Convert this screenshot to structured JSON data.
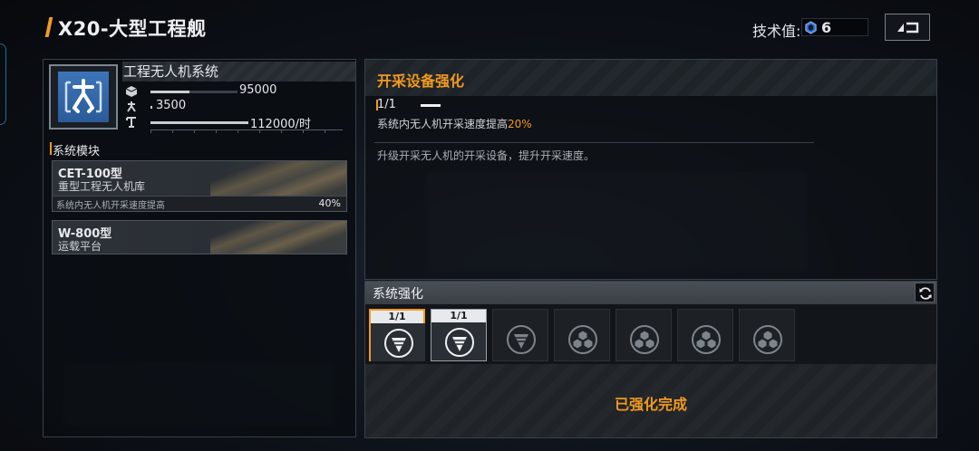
{
  "header": {
    "title": "X20-大型工程舰",
    "tech_label": "技术值:",
    "tech_value": "6",
    "tech_icon": "tech-gem-icon",
    "back_icon": "back-arrow-icon"
  },
  "system": {
    "name": "工程无人机系统",
    "icon": "drone-arm-icon",
    "stats": [
      {
        "icon": "cube-icon",
        "value": "95000",
        "fill": 0.45
      },
      {
        "icon": "drone-icon",
        "value": "3500",
        "fill": 0.02
      },
      {
        "icon": "crane-icon",
        "value": "112000/时",
        "fill": 0.5
      }
    ]
  },
  "modules": {
    "label": "系统模块",
    "items": [
      {
        "code": "CET-100型",
        "type": "重型工程无人机库",
        "desc": "系统内无人机开采速度提高",
        "pct": "40%"
      },
      {
        "code": "W-800型",
        "type": "运载平台"
      }
    ]
  },
  "upgrade": {
    "title": "开采设备强化",
    "level": "1/1",
    "effect_prefix": "系统内无人机开采速度提高",
    "effect_value": "20%",
    "description": "升级开采无人机的开采设备，提升开采速度。"
  },
  "enhance": {
    "title": "系统强化",
    "refresh_icon": "refresh-icon",
    "slots": [
      {
        "level": "1/1",
        "icon": "drill-icon",
        "state": "selected"
      },
      {
        "level": "1/1",
        "icon": "drill-icon",
        "state": "done"
      },
      {
        "level": "",
        "icon": "drill-icon",
        "state": "locked"
      },
      {
        "level": "",
        "icon": "cubes-icon",
        "state": "locked"
      },
      {
        "level": "",
        "icon": "cubes-icon",
        "state": "locked"
      },
      {
        "level": "",
        "icon": "cubes-icon",
        "state": "locked"
      },
      {
        "level": "",
        "icon": "cubes-icon",
        "state": "locked"
      }
    ],
    "status": "已强化完成"
  },
  "colors": {
    "accent": "#f39a1e",
    "icon_blue": "#3d74b8"
  }
}
